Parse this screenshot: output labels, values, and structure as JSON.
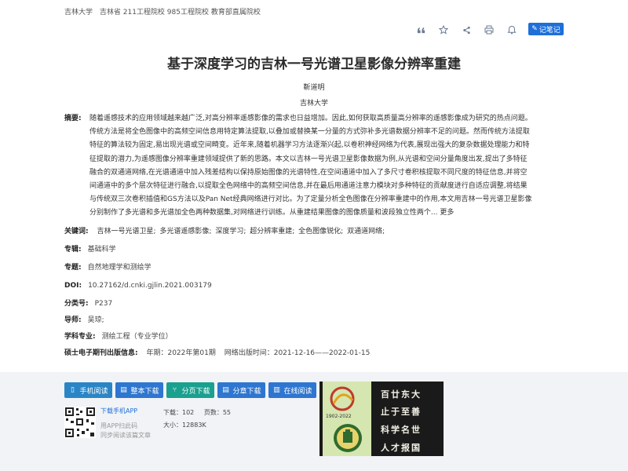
{
  "header": {
    "institution_info": [
      "吉林大学",
      "吉林省 211工程院校 985工程院校 教育部直属院校"
    ],
    "toolbar_icons": [
      "quote-icon",
      "star-icon",
      "share-icon",
      "print-icon",
      "bell-icon"
    ],
    "note_button": "记笔记"
  },
  "paper": {
    "title": "基于深度学习的吉林一号光谱卫星影像分辨率重建",
    "author": "靳道明",
    "organization": "吉林大学",
    "abstract_label": "摘要:",
    "abstract_lines": [
      "随着遥感技术的应用领域越来越广泛,对高分辨率遥感影像的需求也日益增加。因此,如何获取高质量高分辨率的遥感影像成为研究的热点问题。",
      "传统方法是将全色图像中的高频空间信息用特定算法提取,以叠加或替换某一分量的方式弥补多光谱数据分辨率不足的问题。然而传统方法提取",
      "特征的算法较为固定,易出现光谱或空间畸变。近年来,随着机器学习方法逐渐兴起,以卷积神经网络为代表,展现出强大的复杂数据处理能力和特",
      "征提取的潜力,为遥感图像分辨率重建领域提供了新的思路。本文以吉林一号光谱卫星影像数据为例,从光谱和空间分量角度出发,提出了多特征",
      "融合的双通道网络,在光谱通道中加入残差结构以保持原始图像的光谱特性,在空间通道中加入了多尺寸卷积核提取不同尺度的特征信息,并将空",
      "间通道中的多个层次特征进行融合,以提取全色网络中的高频空间信息,并在最后用通道注意力模块对多种特征的贡献度进行自适应调整,将结果",
      "与传统双三次卷积插值和GS方法以及Pan Net经典网络进行对比。为了定量分析全色图像在分辨率重建中的作用,本文用吉林一号光谱卫星影像",
      "分别制作了多光谱和多光谱加全色两种数据集,对网络进行训练。从重建结果图像的图像质量和波段独立性两个..."
    ],
    "more_label": "更多",
    "keywords_label": "关键词:",
    "keywords": [
      "吉林一号光谱卫星;",
      "多光谱遥感影像;",
      "深度学习;",
      "超分辨率重建;",
      "全色图像锐化;",
      "双通道网络;"
    ],
    "fields": [
      {
        "label": "专辑:",
        "value": "基础科学"
      },
      {
        "label": "专题:",
        "value": "自然地理学和测绘学"
      },
      {
        "label": "DOI:",
        "value": "10.27162/d.cnki.gjlin.2021.003179"
      },
      {
        "label": "分类号:",
        "value": "P237"
      },
      {
        "label": "导师:",
        "value": "吴琼;"
      },
      {
        "label": "学科专业:",
        "value": "测绘工程（专业学位）"
      }
    ],
    "pub_label": "硕士电子期刊出版信息:",
    "pub_year": "年期：2022年第01期",
    "pub_online": "网络出版时间：2021-12-16——2022-01-15"
  },
  "downloads": {
    "buttons": [
      {
        "label": "手机阅读",
        "icon": "phone-icon"
      },
      {
        "label": "整本下载",
        "icon": "download-icon"
      },
      {
        "label": "分页下载",
        "icon": "split-icon"
      },
      {
        "label": "分章下载",
        "icon": "chapter-icon"
      },
      {
        "label": "在线阅读",
        "icon": "book-icon"
      }
    ],
    "app_link": "下载手机APP",
    "app_tip1": "用APP扫此码",
    "app_tip2": "同步阅读该篇文章",
    "downloads_count": "下载：102",
    "pages_count": "页数：55",
    "size": "大小：12883K"
  },
  "banner": {
    "slogan": [
      "百廿东大",
      "止于至善",
      "科学名世",
      "人才报国"
    ],
    "year_mark": "1902-2022"
  },
  "colors": {
    "accent": "#1e6fd9",
    "btn_blue": "#2a85c5",
    "btn_green": "#1aa08f",
    "footer_bg": "#f1f3f6"
  }
}
